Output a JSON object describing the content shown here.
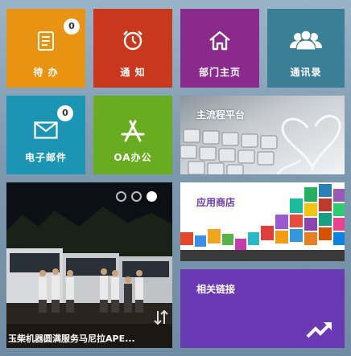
{
  "tiles": {
    "todo": {
      "label": "待 办",
      "badge": "0",
      "icon": "document-icon",
      "color": "#e89412"
    },
    "notice": {
      "label": "通 知",
      "icon": "alarm-clock-icon",
      "color": "#c9381d"
    },
    "dept": {
      "label": "部门主页",
      "icon": "home-icon",
      "color": "#8b2a8d"
    },
    "contacts": {
      "label": "通讯录",
      "icon": "users-icon",
      "color": "#3a7f96"
    },
    "mail": {
      "label": "电子邮件",
      "badge": "0",
      "icon": "envelope-icon",
      "color": "#1c94b3"
    },
    "oa": {
      "label": "OA办公",
      "icon": "app-store-icon",
      "color": "#6aac20"
    },
    "main_platform": {
      "label": "主流程平台"
    },
    "photo": {
      "caption": "玉柴机器圆满服务马尼拉APE...",
      "icon": "swap-arrows-icon"
    },
    "app_store": {
      "label": "应用商店"
    },
    "links": {
      "label": "相关链接",
      "icon": "trend-up-icon",
      "color": "#6a3ab5"
    }
  },
  "carousel": {
    "dots": 3,
    "active_index": 2
  }
}
